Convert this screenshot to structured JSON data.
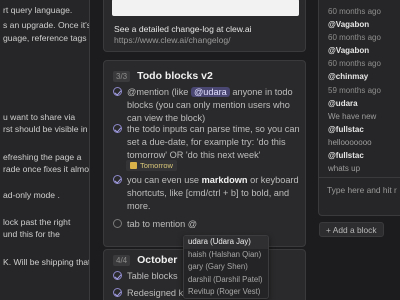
{
  "left_card": {
    "lines": [
      "rt query language.",
      "s an upgrade. Once it's",
      "guage, reference tags",
      "u want to share via",
      "rst should be visible in",
      "efreshing the page a",
      "rade once fixes it almost",
      "ad-only mode .",
      "lock past the right",
      "und this for the",
      "K. Will be shipping that"
    ]
  },
  "changelog": {
    "caption": "See a detailed change-log at clew.ai",
    "url": "https://www.clew.ai/changelog/"
  },
  "todo_block": {
    "count": "3/3",
    "title": "Todo blocks v2",
    "items": [
      {
        "pre": "@mention (like ",
        "mention": "@udara",
        "post": " anyone in todo blocks (you can only mention users who can view the block)"
      },
      {
        "text": "the todo inputs can parse time, so you can set a due-date, for example try: 'do this tomorrow' OR 'do this next week'"
      },
      {
        "pre": "you can even use ",
        "bold": "markdown",
        "post": " or keyboard shortcuts, like [cmd/ctrl + b] to bold, and more."
      }
    ],
    "due_chip": "Tomorrow",
    "draft_value": "tab to mention @"
  },
  "mention_dropdown": {
    "options": [
      "udara (Udara Jay)",
      "haish (Halshan Qian)",
      "gary (Gary Shen)",
      "darshil (Darshil Patel)",
      "Revitup (Roger Vest)"
    ]
  },
  "october_block": {
    "count": "4/4",
    "title": "October",
    "items": [
      "Table blocks",
      "Redesigned kanb"
    ]
  },
  "chat": {
    "lines": [
      {
        "cls": "chat-meta",
        "text": "60 months ago"
      },
      {
        "cls": "chat-author",
        "text": "@Vagabon"
      },
      {
        "cls": "chat-meta",
        "text": "60 months ago"
      },
      {
        "cls": "chat-author",
        "text": "@Vagabon"
      },
      {
        "cls": "chat-meta",
        "text": "60 months ago"
      },
      {
        "cls": "chat-author",
        "text": "@chinmay"
      },
      {
        "cls": "chat-meta",
        "text": "59 months ago"
      },
      {
        "cls": "chat-author",
        "text": "@udara"
      },
      {
        "cls": "chat-msg",
        "text": "We have new"
      },
      {
        "cls": "chat-author",
        "text": "@fullstac"
      },
      {
        "cls": "chat-msg",
        "text": "hellooooooo"
      },
      {
        "cls": "chat-author",
        "text": "@fullstac"
      },
      {
        "cls": "chat-msg",
        "text": "whats up"
      }
    ],
    "input_placeholder": "Type here and hit r"
  },
  "add_block": {
    "label": "+ Add a block"
  }
}
